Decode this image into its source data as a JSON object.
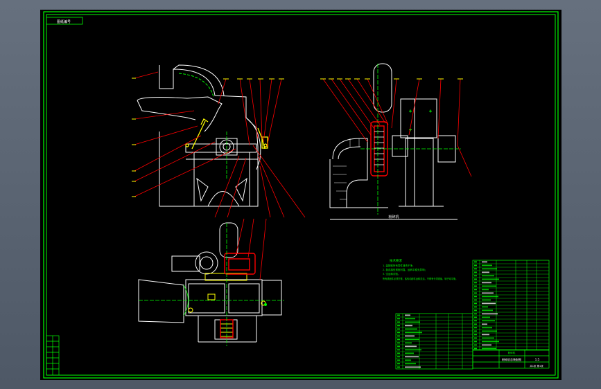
{
  "drawing": {
    "top_left_tag": "图纸编号",
    "tech_title": "技术要求",
    "tech_lines": [
      "1. 装配前所有零件清洗干净，",
      "2. 各连接处紧固可靠，运转平稳无异响；",
      "3. 空运转试验。",
      "所有紧固件必须拧紧，各传动部件运转灵活，不得有卡滞现象，转子动平衡。"
    ],
    "label_bottom_mid": "粉碎机",
    "title_block_name": "粉碎机总装配图",
    "title_block_scale": "1:5",
    "title_block_sheet": "共1张 第1张",
    "title_block_label": "粉碎机"
  },
  "colors": {
    "background": "#000000",
    "frame": "#00ff00",
    "outline": "#ffffff",
    "leader": "#ff0000",
    "centerline": "#00ff00",
    "accent": "#ffff00",
    "table_text": "#00ff00"
  }
}
